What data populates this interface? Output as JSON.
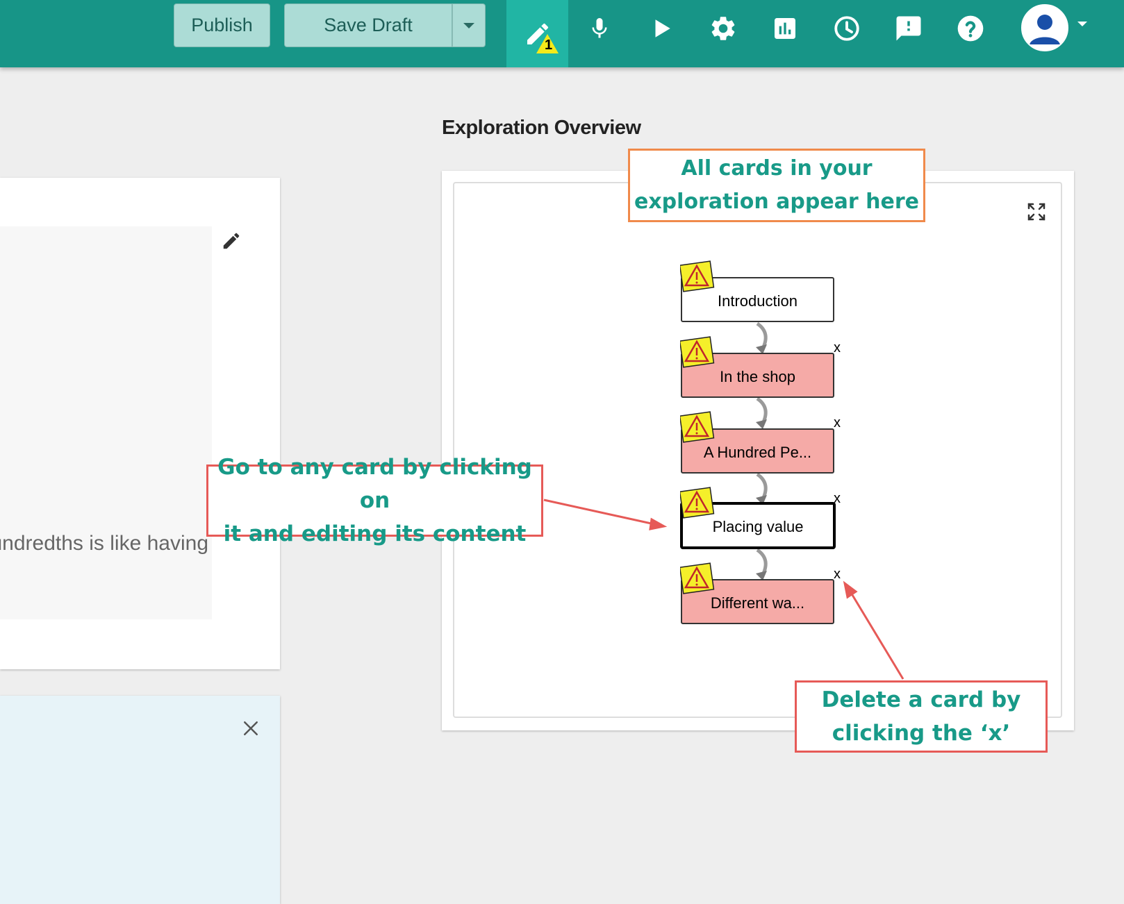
{
  "toolbar": {
    "publish_label": "Publish",
    "save_draft_label": "Save Draft",
    "editor_warning_count": "1",
    "icons": [
      "pencil-icon",
      "microphone-icon",
      "play-icon",
      "gear-icon",
      "stats-icon",
      "history-icon",
      "feedback-icon",
      "help-icon",
      "avatar-icon"
    ]
  },
  "content": {
    "text": "Thinking about hundredths is like having"
  },
  "overview": {
    "title": "Exploration Overview",
    "nodes": [
      {
        "label": "Introduction",
        "state": "initial",
        "deletable": false
      },
      {
        "label": "In the shop",
        "state": "error",
        "deletable": true
      },
      {
        "label": "A Hundred Pe...",
        "state": "error",
        "deletable": true
      },
      {
        "label": "Placing value",
        "state": "selected",
        "deletable": true
      },
      {
        "label": "Different wa...",
        "state": "error",
        "deletable": true
      }
    ],
    "delete_symbol": "x"
  },
  "annotations": {
    "cards_line1": "All cards in your",
    "cards_line2": "exploration appear here",
    "goto_line1": "Go to any card by clicking on",
    "goto_line2": "it and editing its content",
    "delete_line1": "Delete a card by",
    "delete_line2": "clicking the ‘x’"
  },
  "colors": {
    "topbar": "#179587",
    "active_tab": "#21b5a4",
    "node_error": "#f5aaa7",
    "callout_teal_text": "#189a88",
    "callout_orange_border": "#f08a4b",
    "callout_red_border": "#e65a57"
  }
}
